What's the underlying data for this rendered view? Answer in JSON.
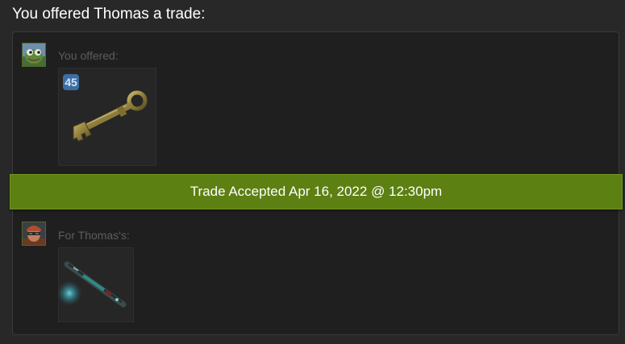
{
  "heading": "You offered Thomas a trade:",
  "my_side": {
    "label": "You offered:",
    "avatar_icon": "frog-avatar-icon",
    "items": [
      {
        "icon": "key-icon",
        "quantity": "45"
      }
    ]
  },
  "status": {
    "text": "Trade Accepted Apr 16, 2022 @ 12:30pm",
    "color": "#5c8012"
  },
  "their_side": {
    "label": "For Thomas's:",
    "avatar_icon": "soldier-avatar-icon",
    "items": [
      {
        "icon": "weapon-icon"
      }
    ]
  },
  "colors": {
    "background": "#282828",
    "panel": "#1f1f1f",
    "badge": "#3c6ea3"
  }
}
